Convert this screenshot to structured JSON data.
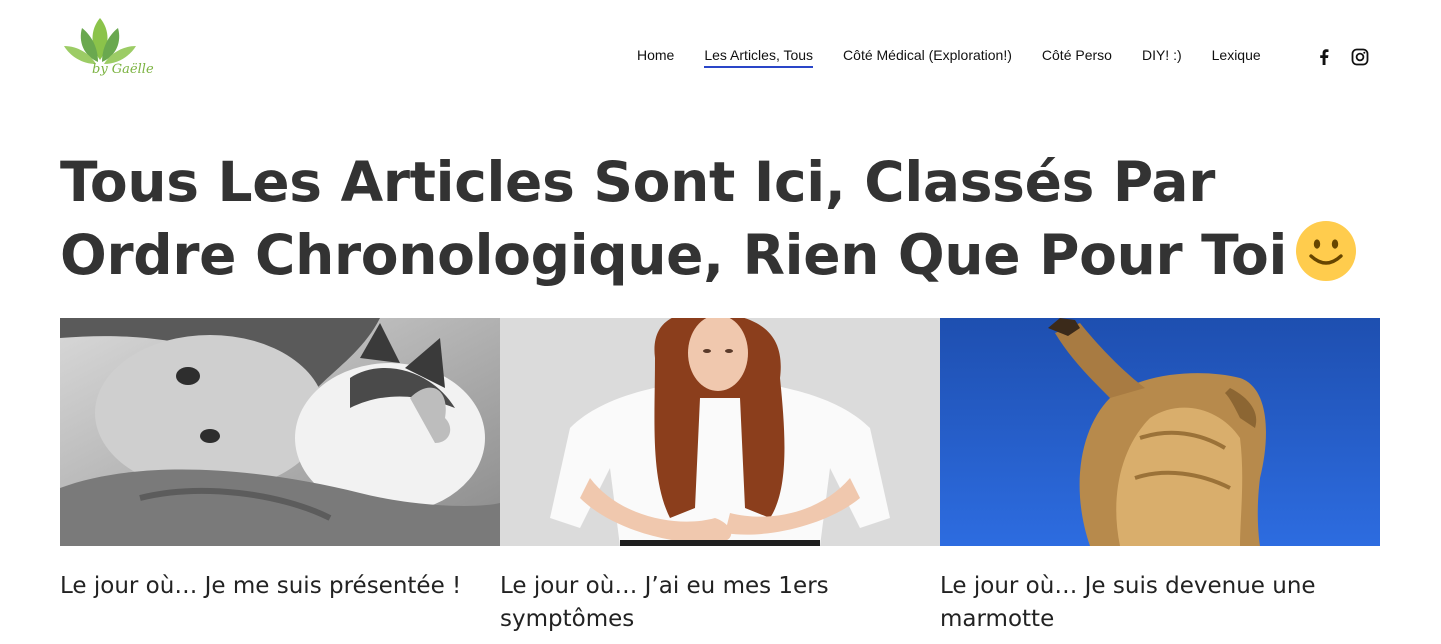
{
  "site": {
    "logo_text": "by Gaëlle",
    "logo_icon": "lotus-leaves-icon",
    "brand_color": "#7cb342"
  },
  "nav": {
    "items": [
      {
        "label": "Home"
      },
      {
        "label": "Les Articles, Tous",
        "active": true
      },
      {
        "label": "Côté Médical (Exploration!)"
      },
      {
        "label": "Côté Perso"
      },
      {
        "label": "DIY! :)"
      },
      {
        "label": "Lexique"
      }
    ],
    "active_underline_color": "#2a46c8"
  },
  "social": {
    "icons": [
      "facebook-icon",
      "instagram-icon"
    ]
  },
  "page": {
    "title": "Tous Les Articles Sont Ici, Classés Par Ordre Chronologique, Rien Que Pour Toi",
    "title_emoji": "smiley-face-icon"
  },
  "articles": [
    {
      "title": "Le jour où… Je me suis présentée !",
      "image": "woman-with-cat-photo"
    },
    {
      "title": "Le jour où… J’ai eu mes 1ers symptômes",
      "image": "woman-holding-stomach-photo"
    },
    {
      "title": "Le jour où… Je suis devenue une marmotte",
      "image": "marmot-stretching-photo"
    }
  ]
}
